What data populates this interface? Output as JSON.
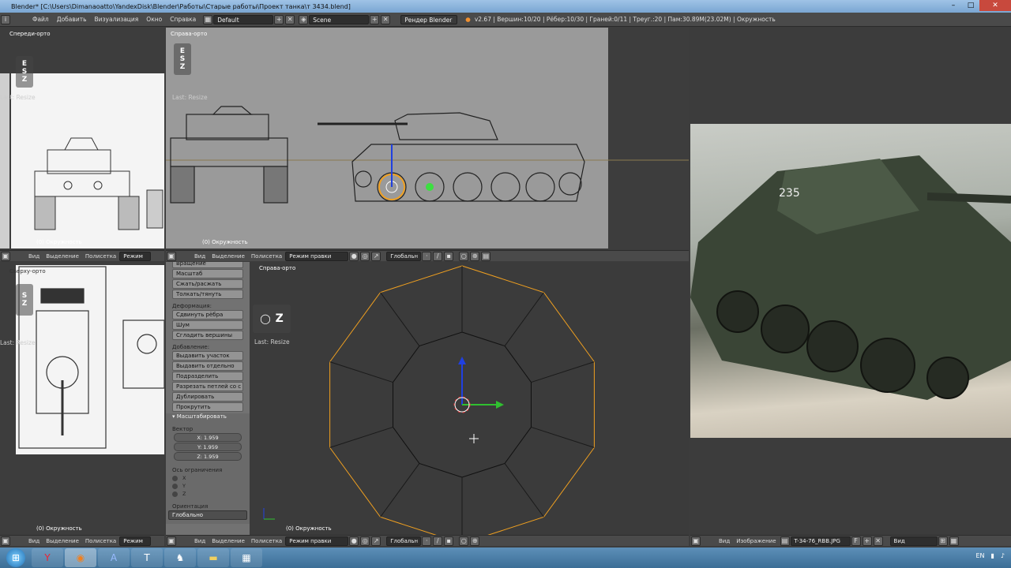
{
  "window": {
    "title": "Blender* [C:\\Users\\Dimanaoatto\\YandexDisk\\Blender\\Работы\\Старые работы\\Проект танка\\т 3434.blend]",
    "minimize": "–",
    "maximize": "□",
    "close": "✕"
  },
  "infobar": {
    "menus": [
      "Файл",
      "Добавить",
      "Визуализация",
      "Окно",
      "Справка"
    ],
    "layout": "Default",
    "scene": "Scene",
    "engine": "Рендер Blender",
    "stats": "v2.67 | Вершин:10/20 | Рёбер:10/30 | Граней:0/11 | Треуг.:20 | Пам:30.89M(23.02M) | Окружность"
  },
  "viewports": {
    "top_left": {
      "label": "Спереди-орто",
      "last_op": "Last: Resize",
      "status": "(0) Окружность"
    },
    "top_middle": {
      "label": "Справа-орто",
      "last_op": "Last: Resize",
      "status": "(0) Окружность"
    },
    "bottom_left": {
      "label": "Сверху-орто",
      "last_op": "Last: Resize",
      "status": "(0) Окружность"
    },
    "main": {
      "label": "Справа-орто",
      "last_op": "Last: Resize",
      "status": "(0) Окружность"
    }
  },
  "headers": {
    "view": "Вид",
    "select": "Выделение",
    "mesh": "Полисетка",
    "mode_short": "Режим",
    "mode": "Режим правки",
    "orientation": "Глобальн",
    "image_menu": "Изображение",
    "image_name": "T-34-76_RBB.JPG",
    "view2": "Вид"
  },
  "toolshelf": {
    "top_buttons": [
      "Вращение",
      "Масштаб",
      "Сжать/расжать",
      "Толкать/тянуть"
    ],
    "deform_title": "Деформация:",
    "deform_buttons": [
      "Сдвинуть рёбра",
      "Шум",
      "Сгладить вершины"
    ],
    "add_title": "Добавление:",
    "add_buttons": [
      "Выдавить участок",
      "Выдавить отдельно",
      "Подразделить",
      "Разрезать петлей со с",
      "Дублировать",
      "Прокрутить"
    ],
    "operator_title": "▾ Масштабировать",
    "vector_title": "Вектор",
    "vector": [
      "X: 1.959",
      "Y: 1.959",
      "Z: 1.959"
    ],
    "constraint_title": "Ось ограничения",
    "axes": [
      "X",
      "Y",
      "Z"
    ],
    "orient_title": "Ориентация",
    "orient_value": "Глобально"
  },
  "taskbar": {
    "lang": "EN"
  },
  "colors": {
    "wire": "#f0a020",
    "ref_bg": "#f4f4f4",
    "viewport": "#3d3d3d"
  }
}
